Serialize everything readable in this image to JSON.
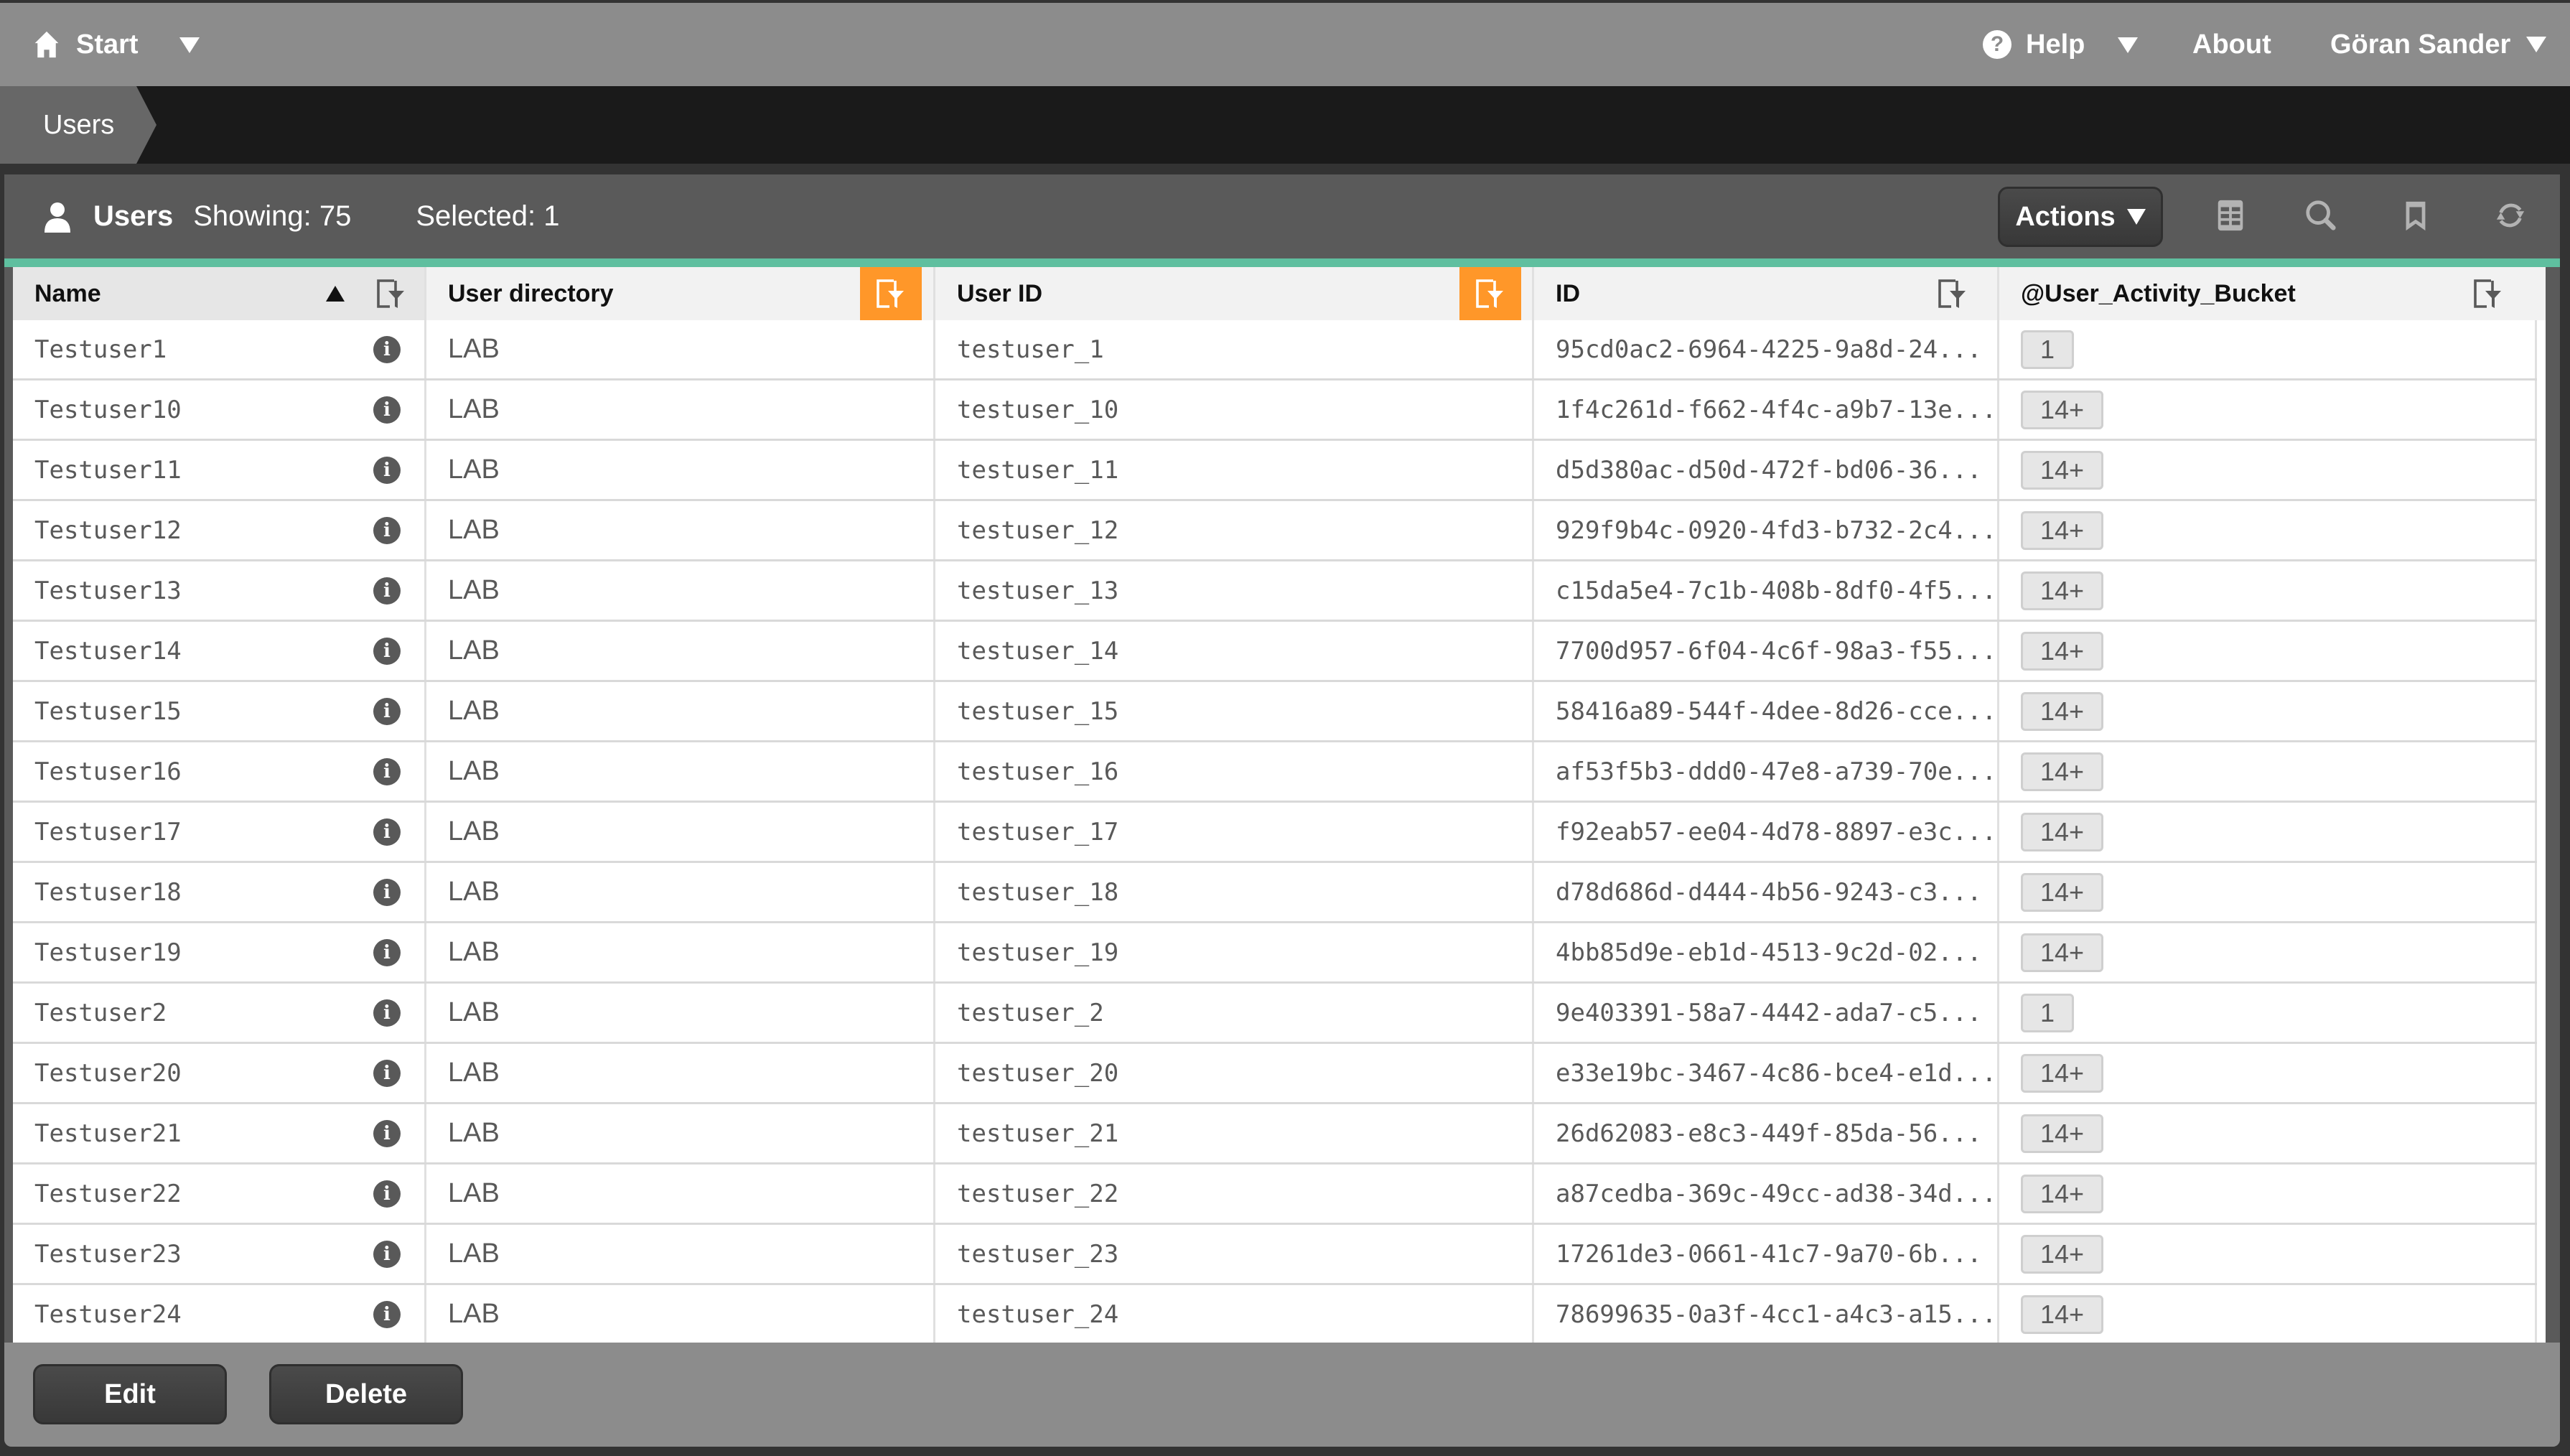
{
  "topbar": {
    "start_label": "Start",
    "help_label": "Help",
    "about_label": "About",
    "user_label": "Göran Sander"
  },
  "breadcrumb": {
    "current": "Users"
  },
  "panel": {
    "title": "Users",
    "showing": "Showing: 75",
    "selected": "Selected: 1",
    "actions_label": "Actions",
    "tools": [
      "table-view-icon",
      "search-icon",
      "bookmark-icon",
      "refresh-icon"
    ]
  },
  "colors": {
    "accent_teal": "#5fbf9f",
    "filter_active": "#ff9729",
    "topbar": "#8c8c8c"
  },
  "table": {
    "columns": [
      {
        "label": "Name",
        "sorted": "ascending",
        "filter_active": false
      },
      {
        "label": "User directory",
        "filter_active": true
      },
      {
        "label": "User ID",
        "filter_active": true
      },
      {
        "label": "ID",
        "filter_active": false
      },
      {
        "label": "@User_Activity_Bucket",
        "filter_active": false
      }
    ],
    "rows": [
      {
        "name": "Testuser1",
        "directory": "LAB",
        "userid": "testuser_1",
        "id": "95cd0ac2-6964-4225-9a8d-24...",
        "bucket": "1"
      },
      {
        "name": "Testuser10",
        "directory": "LAB",
        "userid": "testuser_10",
        "id": "1f4c261d-f662-4f4c-a9b7-13e...",
        "bucket": "14+"
      },
      {
        "name": "Testuser11",
        "directory": "LAB",
        "userid": "testuser_11",
        "id": "d5d380ac-d50d-472f-bd06-36...",
        "bucket": "14+"
      },
      {
        "name": "Testuser12",
        "directory": "LAB",
        "userid": "testuser_12",
        "id": "929f9b4c-0920-4fd3-b732-2c4...",
        "bucket": "14+"
      },
      {
        "name": "Testuser13",
        "directory": "LAB",
        "userid": "testuser_13",
        "id": "c15da5e4-7c1b-408b-8df0-4f5...",
        "bucket": "14+"
      },
      {
        "name": "Testuser14",
        "directory": "LAB",
        "userid": "testuser_14",
        "id": "7700d957-6f04-4c6f-98a3-f55...",
        "bucket": "14+"
      },
      {
        "name": "Testuser15",
        "directory": "LAB",
        "userid": "testuser_15",
        "id": "58416a89-544f-4dee-8d26-cce...",
        "bucket": "14+"
      },
      {
        "name": "Testuser16",
        "directory": "LAB",
        "userid": "testuser_16",
        "id": "af53f5b3-ddd0-47e8-a739-70e...",
        "bucket": "14+"
      },
      {
        "name": "Testuser17",
        "directory": "LAB",
        "userid": "testuser_17",
        "id": "f92eab57-ee04-4d78-8897-e3c...",
        "bucket": "14+"
      },
      {
        "name": "Testuser18",
        "directory": "LAB",
        "userid": "testuser_18",
        "id": "d78d686d-d444-4b56-9243-c3...",
        "bucket": "14+"
      },
      {
        "name": "Testuser19",
        "directory": "LAB",
        "userid": "testuser_19",
        "id": "4bb85d9e-eb1d-4513-9c2d-02...",
        "bucket": "14+"
      },
      {
        "name": "Testuser2",
        "directory": "LAB",
        "userid": "testuser_2",
        "id": "9e403391-58a7-4442-ada7-c5...",
        "bucket": "1"
      },
      {
        "name": "Testuser20",
        "directory": "LAB",
        "userid": "testuser_20",
        "id": "e33e19bc-3467-4c86-bce4-e1d...",
        "bucket": "14+"
      },
      {
        "name": "Testuser21",
        "directory": "LAB",
        "userid": "testuser_21",
        "id": "26d62083-e8c3-449f-85da-56...",
        "bucket": "14+"
      },
      {
        "name": "Testuser22",
        "directory": "LAB",
        "userid": "testuser_22",
        "id": "a87cedba-369c-49cc-ad38-34d...",
        "bucket": "14+"
      },
      {
        "name": "Testuser23",
        "directory": "LAB",
        "userid": "testuser_23",
        "id": "17261de3-0661-41c7-9a70-6b...",
        "bucket": "14+"
      },
      {
        "name": "Testuser24",
        "directory": "LAB",
        "userid": "testuser_24",
        "id": "78699635-0a3f-4cc1-a4c3-a15...",
        "bucket": "14+"
      }
    ]
  },
  "footer": {
    "edit_label": "Edit",
    "delete_label": "Delete"
  }
}
